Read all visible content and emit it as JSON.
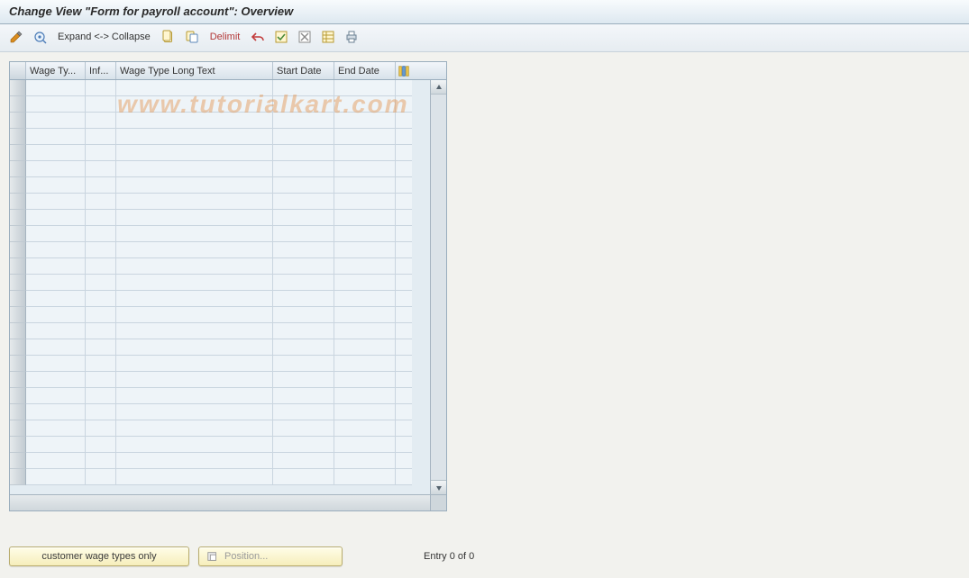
{
  "title": "Change View \"Form for payroll account\": Overview",
  "watermark": "www.tutorialkart.com",
  "toolbar": {
    "change_icon": "change-pencil-icon",
    "other_view_icon": "other-view-icon",
    "expand_collapse_label": "Expand <-> Collapse",
    "new_entries_icon": "new-entries-icon",
    "copy_as_icon": "copy-as-icon",
    "delimit_label": "Delimit",
    "undo_icon": "undo-icon",
    "select_all_icon": "select-all-icon",
    "deselect_all_icon": "deselect-all-icon",
    "config_icon": "table-settings-icon",
    "print_icon": "print-icon"
  },
  "columns": {
    "wage_type": "Wage Ty...",
    "inf": "Inf...",
    "long_text": "Wage Type Long Text",
    "start_date": "Start Date",
    "end_date": "End Date"
  },
  "rows": [
    {
      "wage": "",
      "inf": "",
      "long": "",
      "start": "",
      "end": ""
    },
    {
      "wage": "",
      "inf": "",
      "long": "",
      "start": "",
      "end": ""
    },
    {
      "wage": "",
      "inf": "",
      "long": "",
      "start": "",
      "end": ""
    },
    {
      "wage": "",
      "inf": "",
      "long": "",
      "start": "",
      "end": ""
    },
    {
      "wage": "",
      "inf": "",
      "long": "",
      "start": "",
      "end": ""
    },
    {
      "wage": "",
      "inf": "",
      "long": "",
      "start": "",
      "end": ""
    },
    {
      "wage": "",
      "inf": "",
      "long": "",
      "start": "",
      "end": ""
    },
    {
      "wage": "",
      "inf": "",
      "long": "",
      "start": "",
      "end": ""
    },
    {
      "wage": "",
      "inf": "",
      "long": "",
      "start": "",
      "end": ""
    },
    {
      "wage": "",
      "inf": "",
      "long": "",
      "start": "",
      "end": ""
    },
    {
      "wage": "",
      "inf": "",
      "long": "",
      "start": "",
      "end": ""
    },
    {
      "wage": "",
      "inf": "",
      "long": "",
      "start": "",
      "end": ""
    },
    {
      "wage": "",
      "inf": "",
      "long": "",
      "start": "",
      "end": ""
    },
    {
      "wage": "",
      "inf": "",
      "long": "",
      "start": "",
      "end": ""
    },
    {
      "wage": "",
      "inf": "",
      "long": "",
      "start": "",
      "end": ""
    },
    {
      "wage": "",
      "inf": "",
      "long": "",
      "start": "",
      "end": ""
    },
    {
      "wage": "",
      "inf": "",
      "long": "",
      "start": "",
      "end": ""
    },
    {
      "wage": "",
      "inf": "",
      "long": "",
      "start": "",
      "end": ""
    },
    {
      "wage": "",
      "inf": "",
      "long": "",
      "start": "",
      "end": ""
    },
    {
      "wage": "",
      "inf": "",
      "long": "",
      "start": "",
      "end": ""
    },
    {
      "wage": "",
      "inf": "",
      "long": "",
      "start": "",
      "end": ""
    },
    {
      "wage": "",
      "inf": "",
      "long": "",
      "start": "",
      "end": ""
    },
    {
      "wage": "",
      "inf": "",
      "long": "",
      "start": "",
      "end": ""
    },
    {
      "wage": "",
      "inf": "",
      "long": "",
      "start": "",
      "end": ""
    },
    {
      "wage": "",
      "inf": "",
      "long": "",
      "start": "",
      "end": ""
    }
  ],
  "buttons": {
    "customer_wage_types": "customer wage types only",
    "position": "Position..."
  },
  "status": {
    "entry_text": "Entry 0 of 0"
  }
}
